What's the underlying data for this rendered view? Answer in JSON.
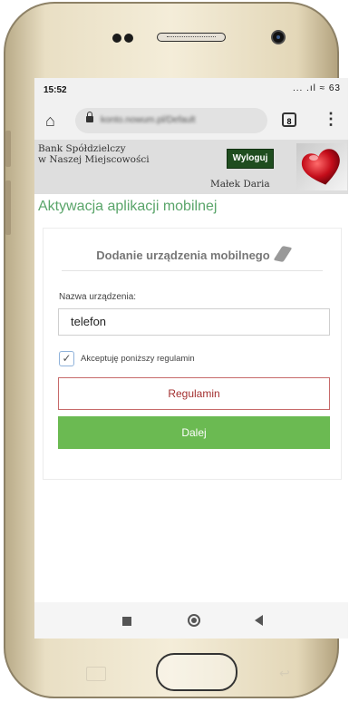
{
  "status_bar": {
    "time": "15:52",
    "icons_text": "... .ıl ≈ 63"
  },
  "browser": {
    "url": "konto.nowum.pl/Default",
    "tabs_count": "8",
    "menu_glyph": "⋮",
    "home_glyph": "⌂"
  },
  "bank_header": {
    "bank_name_line1": "Bank Spółdzielczy",
    "bank_name_line2": "w Naszej Miejscowości",
    "logout_label": "Wyloguj",
    "user_name": "Małek Daria"
  },
  "page": {
    "title": "Aktywacja aplikacji mobilnej"
  },
  "form": {
    "heading": "Dodanie urządzenia mobilnego",
    "device_name_label": "Nazwa urządzenia:",
    "device_name_value": "telefon",
    "accept_checked": true,
    "accept_label": "Akceptuję poniższy regulamin",
    "terms_button_label": "Regulamin",
    "next_button_label": "Dalej"
  },
  "colors": {
    "accent_green": "#6bba52",
    "title_green": "#5aa56a",
    "logout_bg": "#1f4d1f",
    "terms_border": "#c76a6a"
  }
}
